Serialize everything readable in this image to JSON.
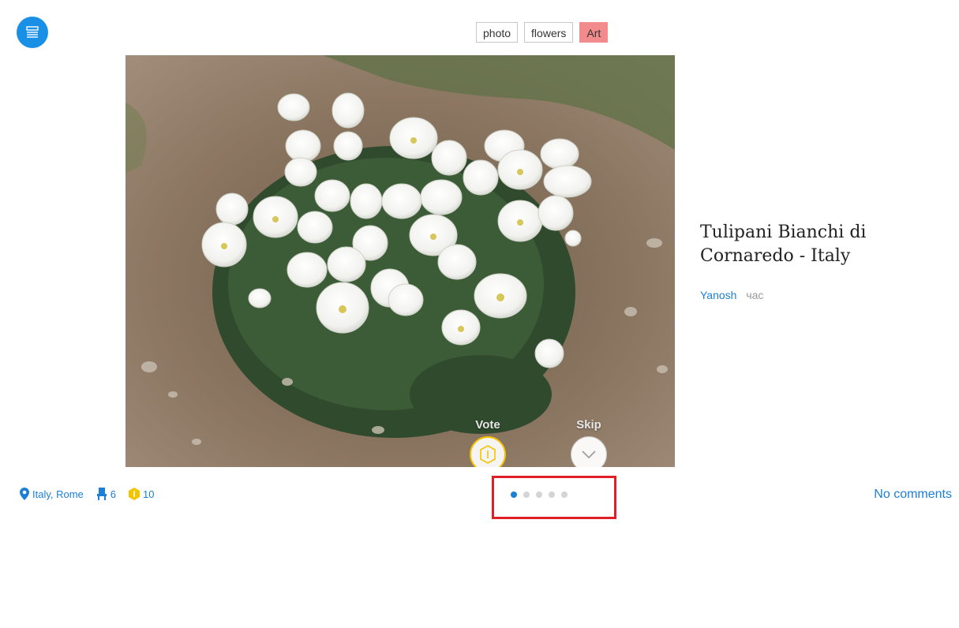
{
  "menu": {
    "icon": "menu-icon"
  },
  "tags": [
    {
      "label": "photo"
    },
    {
      "label": "flowers"
    },
    {
      "label": "Art",
      "color": "#f28b8b"
    }
  ],
  "post": {
    "title": "Tulipani Bianchi di Cornaredo - Italy",
    "author": "Yanosh",
    "time": "час"
  },
  "actions": {
    "vote_label": "Vote",
    "skip_label": "Skip"
  },
  "meta": {
    "location": "Italy, Rome",
    "judges_count": "6",
    "coins_count": "10"
  },
  "pagination": {
    "total": 5,
    "active_index": 0
  },
  "comments": {
    "label": "No comments"
  },
  "colors": {
    "accent": "#1a7fd6",
    "vote": "#f5c400",
    "highlight_box": "#e01e26"
  }
}
